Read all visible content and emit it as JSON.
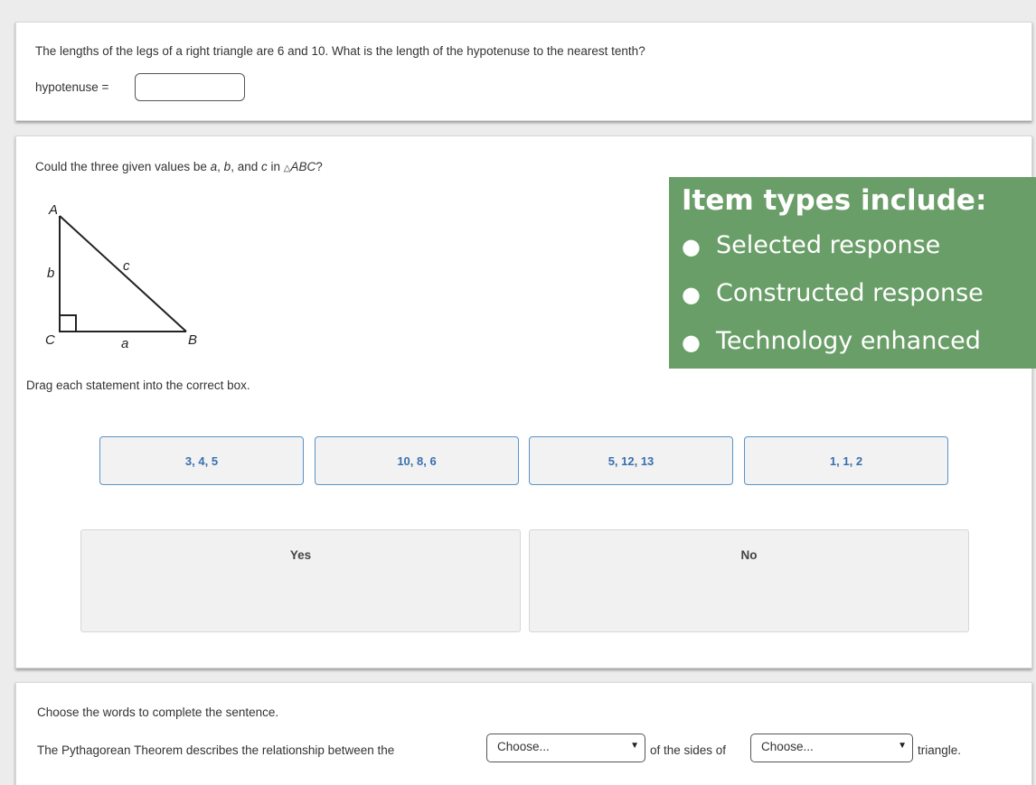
{
  "q1": {
    "prompt": "The lengths of the legs of a right triangle are 6 and 10. What is the length of the hypotenuse to the nearest tenth?",
    "label": "hypotenuse =",
    "answer_value": ""
  },
  "q2": {
    "prompt": "Could the three given values be a, b, and c in △ABC?",
    "triangle": {
      "A": "A",
      "B": "B",
      "C": "C",
      "a": "a",
      "b": "b",
      "c": "c"
    },
    "instruction": "Drag each statement into the correct box.",
    "tiles": [
      "3, 4, 5",
      "10, 8, 6",
      "5, 12, 13",
      "1, 1, 2"
    ],
    "zones": [
      "Yes",
      "No"
    ]
  },
  "callout": {
    "title": "Item types include:",
    "items": [
      "Selected response",
      "Constructed response",
      "Technology enhanced"
    ],
    "color": "#6a9e68"
  },
  "q3": {
    "instruction": "Choose the words to complete the sentence.",
    "sentence_part1": "The Pythagorean Theorem describes the relationship between the",
    "select1": "Choose...",
    "sentence_part2": "of the sides of",
    "select2": "Choose...",
    "sentence_part3": "triangle."
  },
  "colors": {
    "tile_text": "#3a6fb0",
    "tile_border": "#5a93c9"
  }
}
